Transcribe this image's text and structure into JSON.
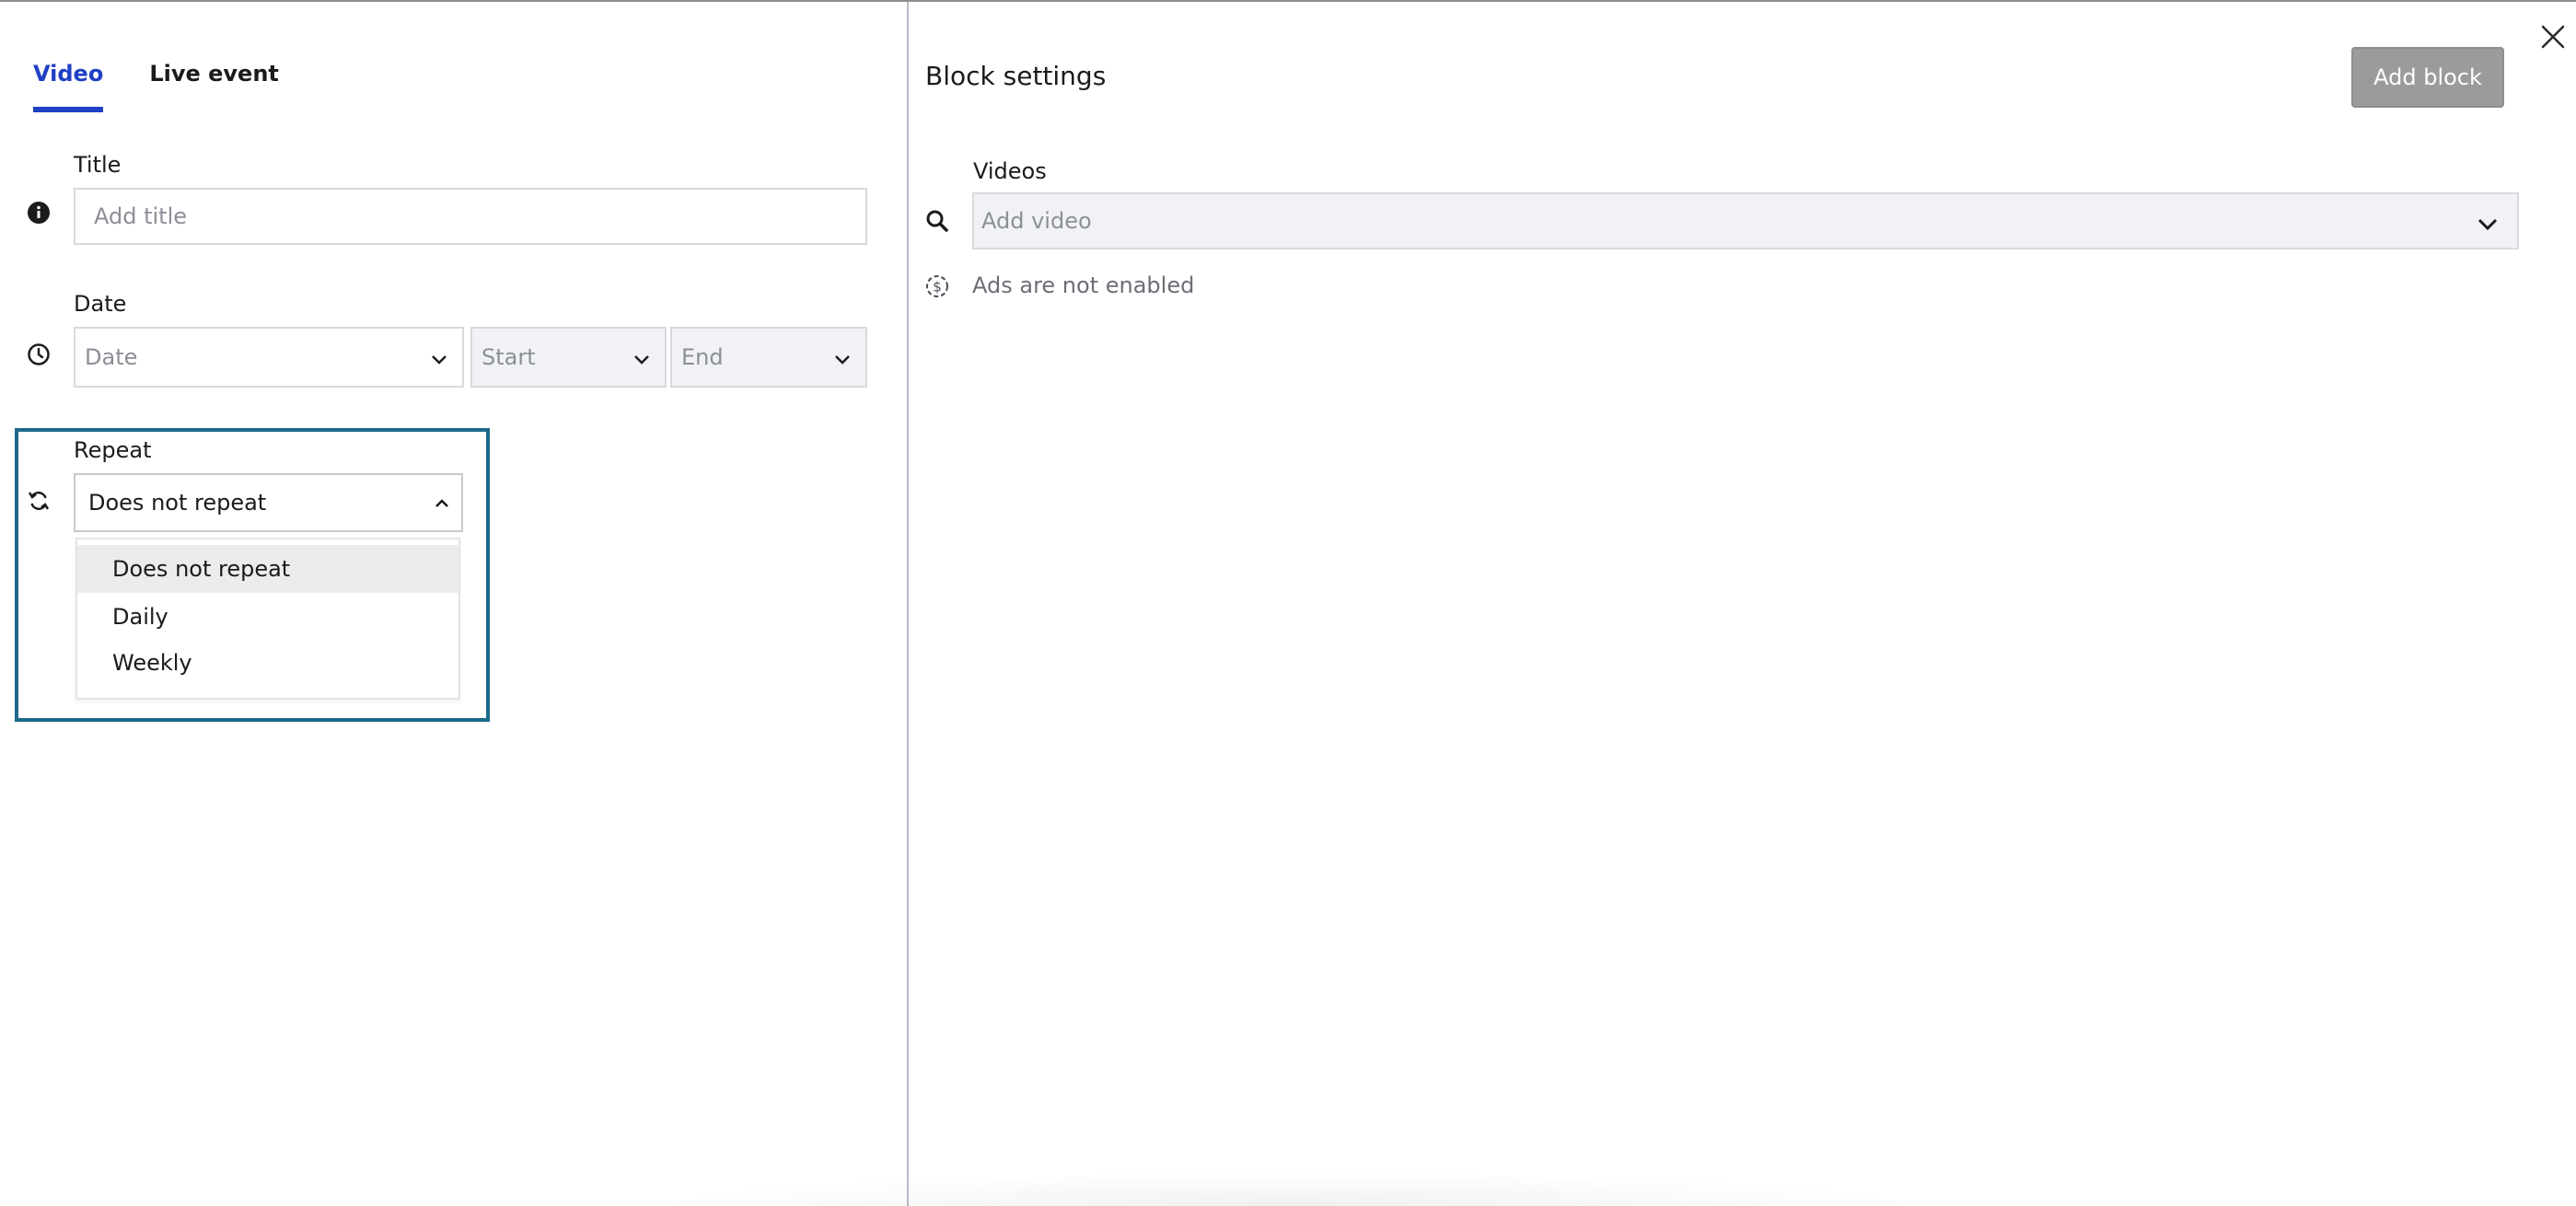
{
  "tabs": [
    {
      "label": "Video",
      "active": true
    },
    {
      "label": "Live event",
      "active": false
    }
  ],
  "title_field": {
    "label": "Title",
    "placeholder": "Add title",
    "icon": "info-icon"
  },
  "date_field": {
    "label": "Date",
    "icon": "clock-icon",
    "date_placeholder": "Date",
    "start_placeholder": "Start",
    "end_placeholder": "End"
  },
  "repeat_field": {
    "label": "Repeat",
    "icon": "repeat-icon",
    "selected": "Does not repeat",
    "options": [
      "Does not repeat",
      "Daily",
      "Weekly"
    ]
  },
  "block_settings": {
    "title": "Block settings",
    "add_block_label": "Add block",
    "videos_label": "Videos",
    "video_placeholder": "Add video",
    "ads_status": "Ads are not enabled"
  },
  "colors": {
    "accent": "#1f3fc5",
    "focus_frame": "#1b6a8a",
    "add_block_bg": "#9b9b9b"
  }
}
